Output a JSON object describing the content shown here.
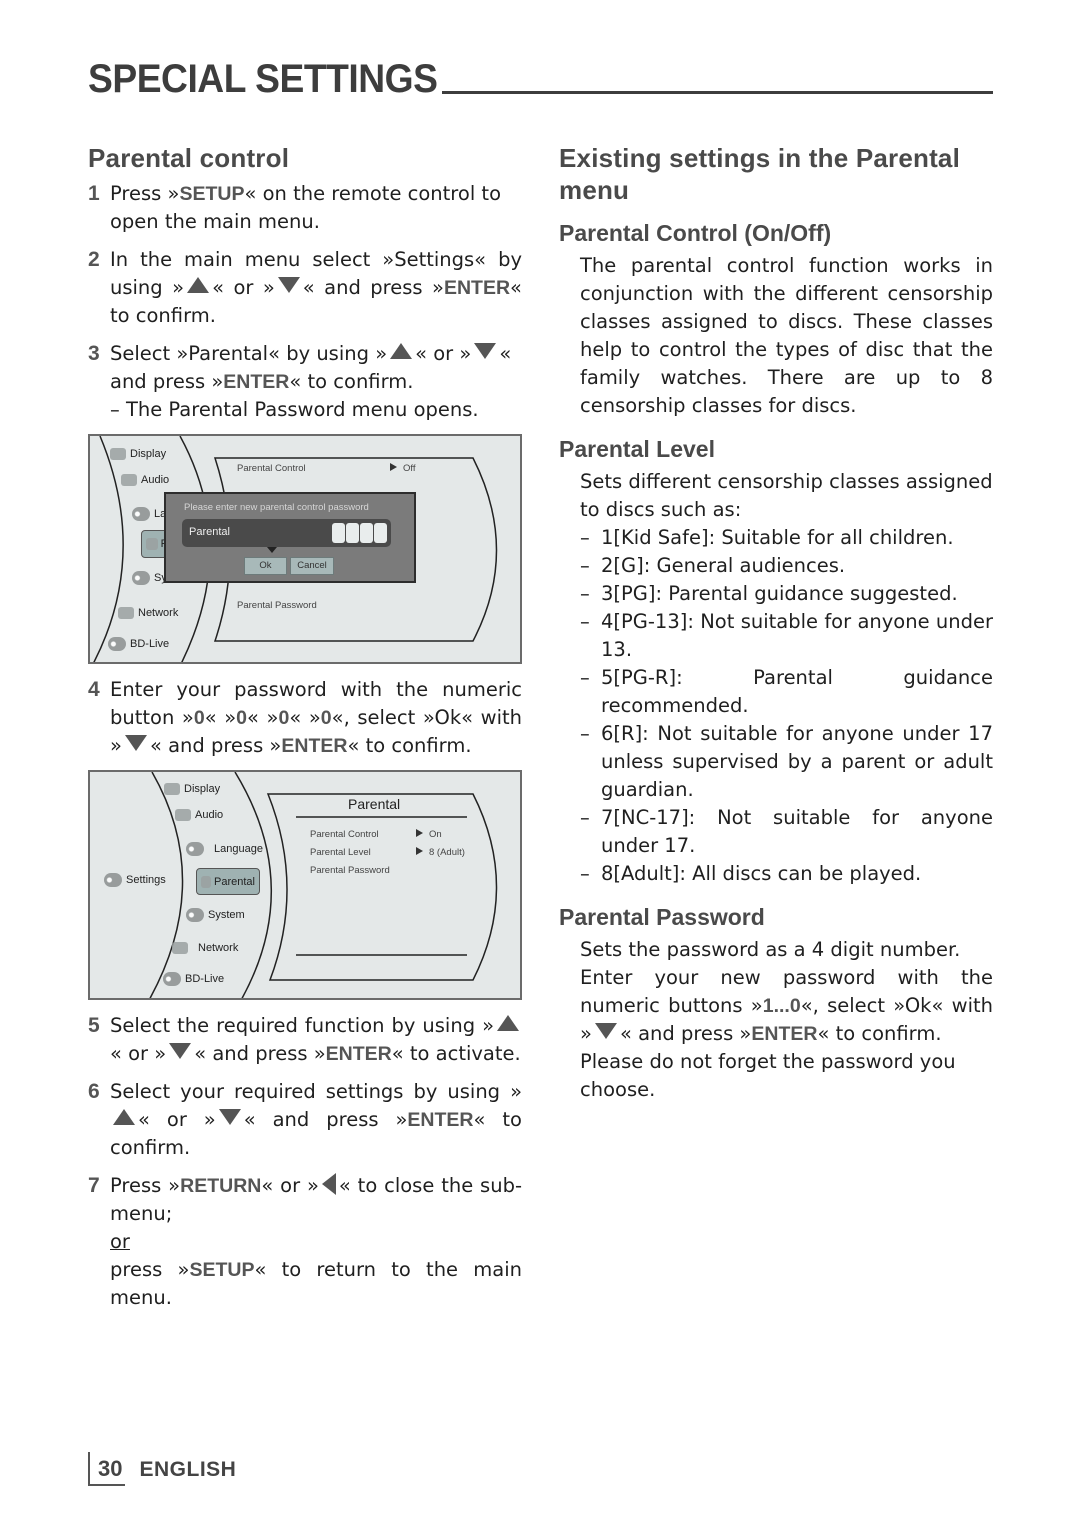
{
  "header": {
    "title": "SPECIAL SETTINGS"
  },
  "left": {
    "heading": "Parental control",
    "steps": [
      {
        "num": "1",
        "pre": "Press »",
        "key": "SETUP",
        "post": "« on the remote control to open the main menu."
      },
      {
        "num": "2",
        "pre": "In the main menu select »Settings« by using",
        "a": "»",
        "b": "« or »",
        "c": "« and press »",
        "key": "ENTER",
        "post": "« to confirm."
      },
      {
        "num": "3",
        "pre": "Select »Parental« by using »",
        "b": "« or »",
        "c": "« and press »",
        "key": "ENTER",
        "post": "« to confirm.",
        "note": "– The Parental Password menu opens."
      },
      {
        "num": "4",
        "pre": "Enter your password with the numeric button",
        "zeros": [
          "0",
          "0",
          "0",
          "0"
        ],
        "mid": ", select »Ok« with »",
        "c": "« and press »",
        "key": "ENTER",
        "post": "« to confirm."
      },
      {
        "num": "5",
        "pre": "Select the required function by using »",
        "b": "« or »",
        "c": "« and press »",
        "key": "ENTER",
        "post": "« to activate."
      },
      {
        "num": "6",
        "pre": "Select your required settings by using »",
        "b": "« or »",
        "c": "« and press »",
        "key": "ENTER",
        "post": "« to confirm."
      },
      {
        "num": "7",
        "pre": "Press »",
        "key": "RETURN",
        "mid": "« or »",
        "post": "« to close the sub-menu;",
        "or": "or",
        "alt_pre": "press »",
        "alt_key": "SETUP",
        "alt_post": "« to return to the main menu."
      }
    ],
    "screen1": {
      "menu": [
        "Display",
        "Audio",
        "La",
        "P",
        "System",
        "Network",
        "BD-Live"
      ],
      "panel": {
        "row1_label": "Parental Control",
        "row1_value": "Off",
        "row3_label": "Parental Password"
      },
      "dialog": {
        "prompt": "Please enter new parental control password",
        "field_label": "Parental",
        "ok": "Ok",
        "cancel": "Cancel"
      }
    },
    "screen2": {
      "root": "Settings",
      "menu": [
        "Display",
        "Audio",
        "Language",
        "Parental",
        "System",
        "Network",
        "BD-Live"
      ],
      "panel": {
        "title": "Parental",
        "rows": [
          {
            "label": "Parental Control",
            "value": "On"
          },
          {
            "label": "Parental Level",
            "value": "8 (Adult)"
          },
          {
            "label": "Parental Password",
            "value": ""
          }
        ]
      }
    }
  },
  "right": {
    "heading": "Existing settings in the Parental menu",
    "control": {
      "title": "Parental Control (On/Off)",
      "text": "The parental control function works in conjunction with the different censorship classes assigned to discs. These classes help to control the types of disc that the family watches. There are up to 8 censorship classes for discs."
    },
    "level": {
      "title": "Parental Level",
      "intro": "Sets different censorship classes assigned to discs such as:",
      "items": [
        "1[Kid Safe]: Suitable for all children.",
        "2[G]: General audiences.",
        "3[PG]: Parental guidance suggested.",
        "4[PG-13]: Not suitable for anyone under 13.",
        "5[PG-R]: Parental guidance recommended.",
        "6[R]: Not suitable for anyone under 17 unless supervised by a parent or adult guardian.",
        "7[NC-17]: Not suitable for anyone under 17.",
        "8[Adult]: All discs can be played."
      ]
    },
    "password": {
      "title": "Parental Password",
      "line1": "Sets the password as a 4 digit number.",
      "line2_pre": "Enter your new password with the numeric buttons »",
      "line2_key": "1...0",
      "line2_mid": "«, select »Ok« with »",
      "line2_post": "« and press »",
      "line2_key2": "ENTER",
      "line2_end": "« to confirm.",
      "line3": "Please do not forget the password you choose."
    }
  },
  "footer": {
    "page_number": "30",
    "language": "ENGLISH"
  }
}
